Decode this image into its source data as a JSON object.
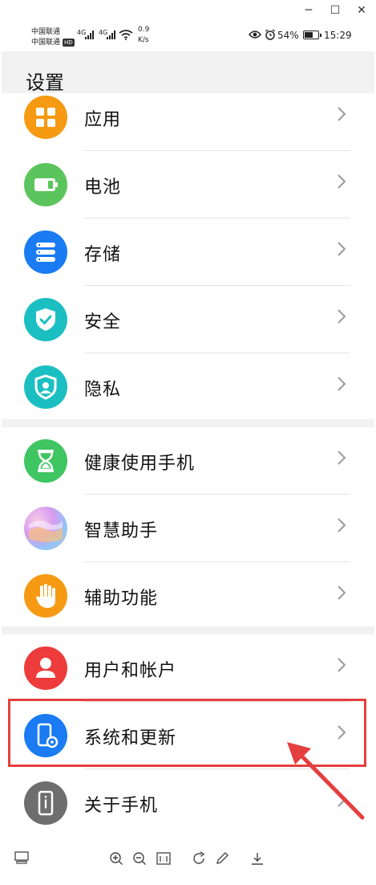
{
  "window": {
    "minimize": "─",
    "maximize": "☐",
    "close": "✕"
  },
  "status": {
    "carrier1": "中国联通",
    "carrier2": "中国联通",
    "hd": "HD",
    "net1": "4G",
    "net2": "4G",
    "speed_value": "0.9",
    "speed_unit": "K/s",
    "battery_percent": "54%",
    "battery_level": 0.54,
    "time": "15:29"
  },
  "page": {
    "title": "设置"
  },
  "groups": [
    {
      "items": [
        {
          "label": "应用",
          "icon": "apps-icon",
          "color": "#F59A12"
        },
        {
          "label": "电池",
          "icon": "battery-icon",
          "color": "#5CC45D"
        },
        {
          "label": "存储",
          "icon": "storage-icon",
          "color": "#1A7BF2"
        },
        {
          "label": "安全",
          "icon": "security-shield-icon",
          "color": "#1BBFC2"
        },
        {
          "label": "隐私",
          "icon": "privacy-icon",
          "color": "#1BBFC2"
        }
      ]
    },
    {
      "items": [
        {
          "label": "健康使用手机",
          "icon": "hourglass-icon",
          "color": "#3FC562"
        },
        {
          "label": "智慧助手",
          "icon": "assistant-icon",
          "color": "#C88AF0"
        },
        {
          "label": "辅助功能",
          "icon": "hand-icon",
          "color": "#F59A12"
        }
      ]
    },
    {
      "items": [
        {
          "label": "用户和帐户",
          "icon": "user-icon",
          "color": "#EE3B3B"
        },
        {
          "label": "系统和更新",
          "icon": "system-update-icon",
          "color": "#1A7BF2"
        },
        {
          "label": "关于手机",
          "icon": "about-phone-icon",
          "color": "#6E6E6E"
        }
      ]
    }
  ],
  "annotation": {
    "highlight_color": "#E53E3E"
  }
}
